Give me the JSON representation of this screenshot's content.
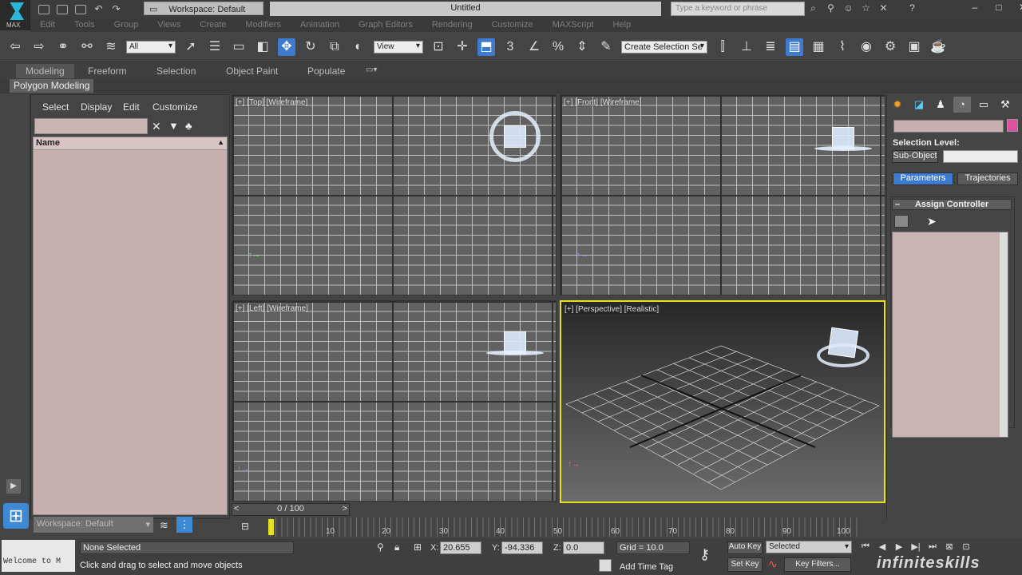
{
  "app": {
    "logo_text": "MAX",
    "workspace": "Workspace: Default",
    "title": "Untitled",
    "search_placeholder": "Type a keyword or phrase"
  },
  "menu": [
    "Edit",
    "Tools",
    "Group",
    "Views",
    "Create",
    "Modifiers",
    "Animation",
    "Graph Editors",
    "Rendering",
    "Customize",
    "MAXScript",
    "Help"
  ],
  "toolbar": {
    "filter_value": "All",
    "ref_coord_value": "View",
    "named_selection": "Create Selection Se"
  },
  "ribbon": {
    "tabs": [
      "Modeling",
      "Freeform",
      "Selection",
      "Object Paint",
      "Populate"
    ],
    "active_panel": "Polygon Modeling"
  },
  "scene_explorer": {
    "menus": [
      "Select",
      "Display",
      "Edit",
      "Customize"
    ],
    "column_header": "Name",
    "workspace_select": "Workspace: Default"
  },
  "viewports": {
    "top": "[+] [Top] [Wireframe]",
    "front": "[+] [Front] [Wireframe]",
    "left": "[+] [Left] [Wireframe]",
    "perspective": "[+] [Perspective] [Realistic]"
  },
  "command_panel": {
    "selection_level_label": "Selection Level:",
    "sub_object_button": "Sub-Object",
    "tab_parameters": "Parameters",
    "tab_trajectories": "Trajectories",
    "rollout_title": "Assign Controller"
  },
  "timeline": {
    "frame_display": "0 / 100",
    "ticks": [
      "10",
      "20",
      "30",
      "40",
      "50",
      "60",
      "70",
      "80",
      "90",
      "100"
    ]
  },
  "status": {
    "welcome": "Welcome to M",
    "selection": "None Selected",
    "prompt": "Click and drag to select and move objects",
    "x_label": "X:",
    "x_value": "20.655",
    "y_label": "Y:",
    "y_value": "-94.336",
    "z_label": "Z:",
    "z_value": "0.0",
    "grid": "Grid = 10.0",
    "add_time_tag": "Add Time Tag",
    "auto_key": "Auto Key",
    "auto_key_select": "Selected",
    "set_key": "Set Key",
    "key_filters": "Key Filters..."
  },
  "watermark": "infiniteskills"
}
